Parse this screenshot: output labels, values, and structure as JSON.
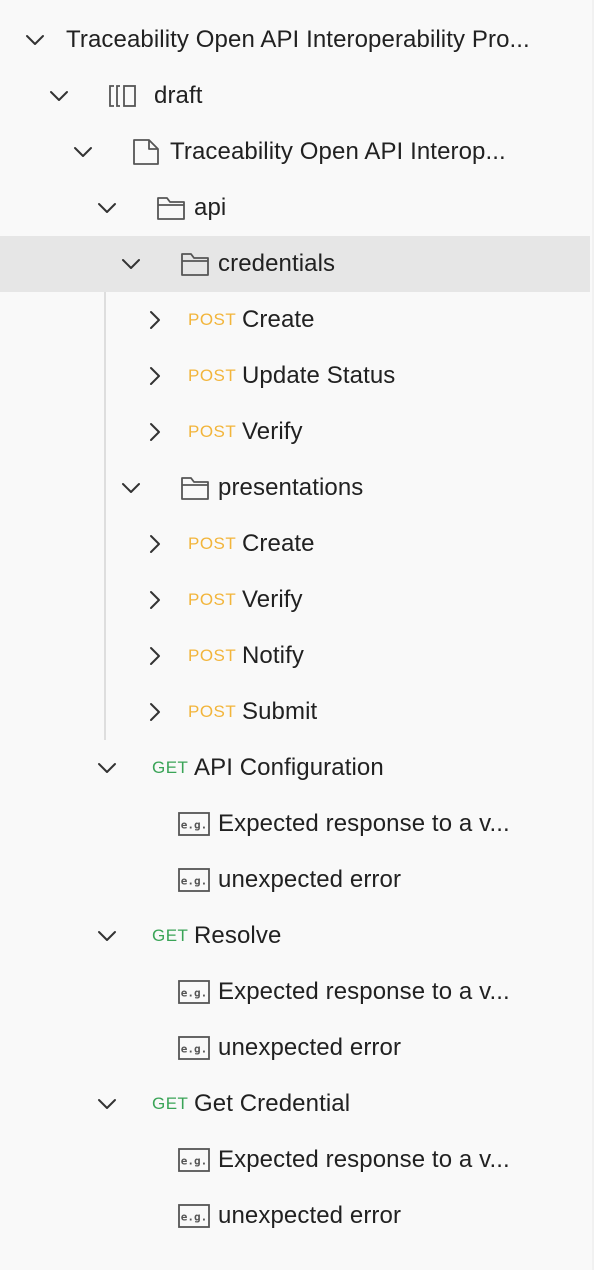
{
  "tree": {
    "root": {
      "label": "Traceability Open API Interoperability Pro..."
    },
    "draft": {
      "label": "draft"
    },
    "spec": {
      "label": "Traceability Open API Interop..."
    },
    "api": {
      "label": "api"
    },
    "credentials": {
      "label": "credentials",
      "items": [
        {
          "method": "POST",
          "label": "Create"
        },
        {
          "method": "POST",
          "label": "Update Status"
        },
        {
          "method": "POST",
          "label": "Verify"
        }
      ]
    },
    "presentations": {
      "label": "presentations",
      "items": [
        {
          "method": "POST",
          "label": "Create"
        },
        {
          "method": "POST",
          "label": "Verify"
        },
        {
          "method": "POST",
          "label": "Notify"
        },
        {
          "method": "POST",
          "label": "Submit"
        }
      ]
    },
    "get_requests": [
      {
        "method": "GET",
        "label": "API Configuration",
        "examples": [
          {
            "badge": "e.g.",
            "label": "Expected response to a v..."
          },
          {
            "badge": "e.g.",
            "label": "unexpected error"
          }
        ]
      },
      {
        "method": "GET",
        "label": "Resolve",
        "examples": [
          {
            "badge": "e.g.",
            "label": "Expected response to a v..."
          },
          {
            "badge": "e.g.",
            "label": "unexpected error"
          }
        ]
      },
      {
        "method": "GET",
        "label": "Get Credential",
        "examples": [
          {
            "badge": "e.g.",
            "label": "Expected response to a v..."
          },
          {
            "badge": "e.g.",
            "label": "unexpected error"
          }
        ]
      }
    ]
  },
  "colors": {
    "post": "#f2b53b",
    "get": "#3aa457",
    "selected_bg": "#e6e6e6",
    "background": "#f9f9f9"
  },
  "selected": "credentials"
}
